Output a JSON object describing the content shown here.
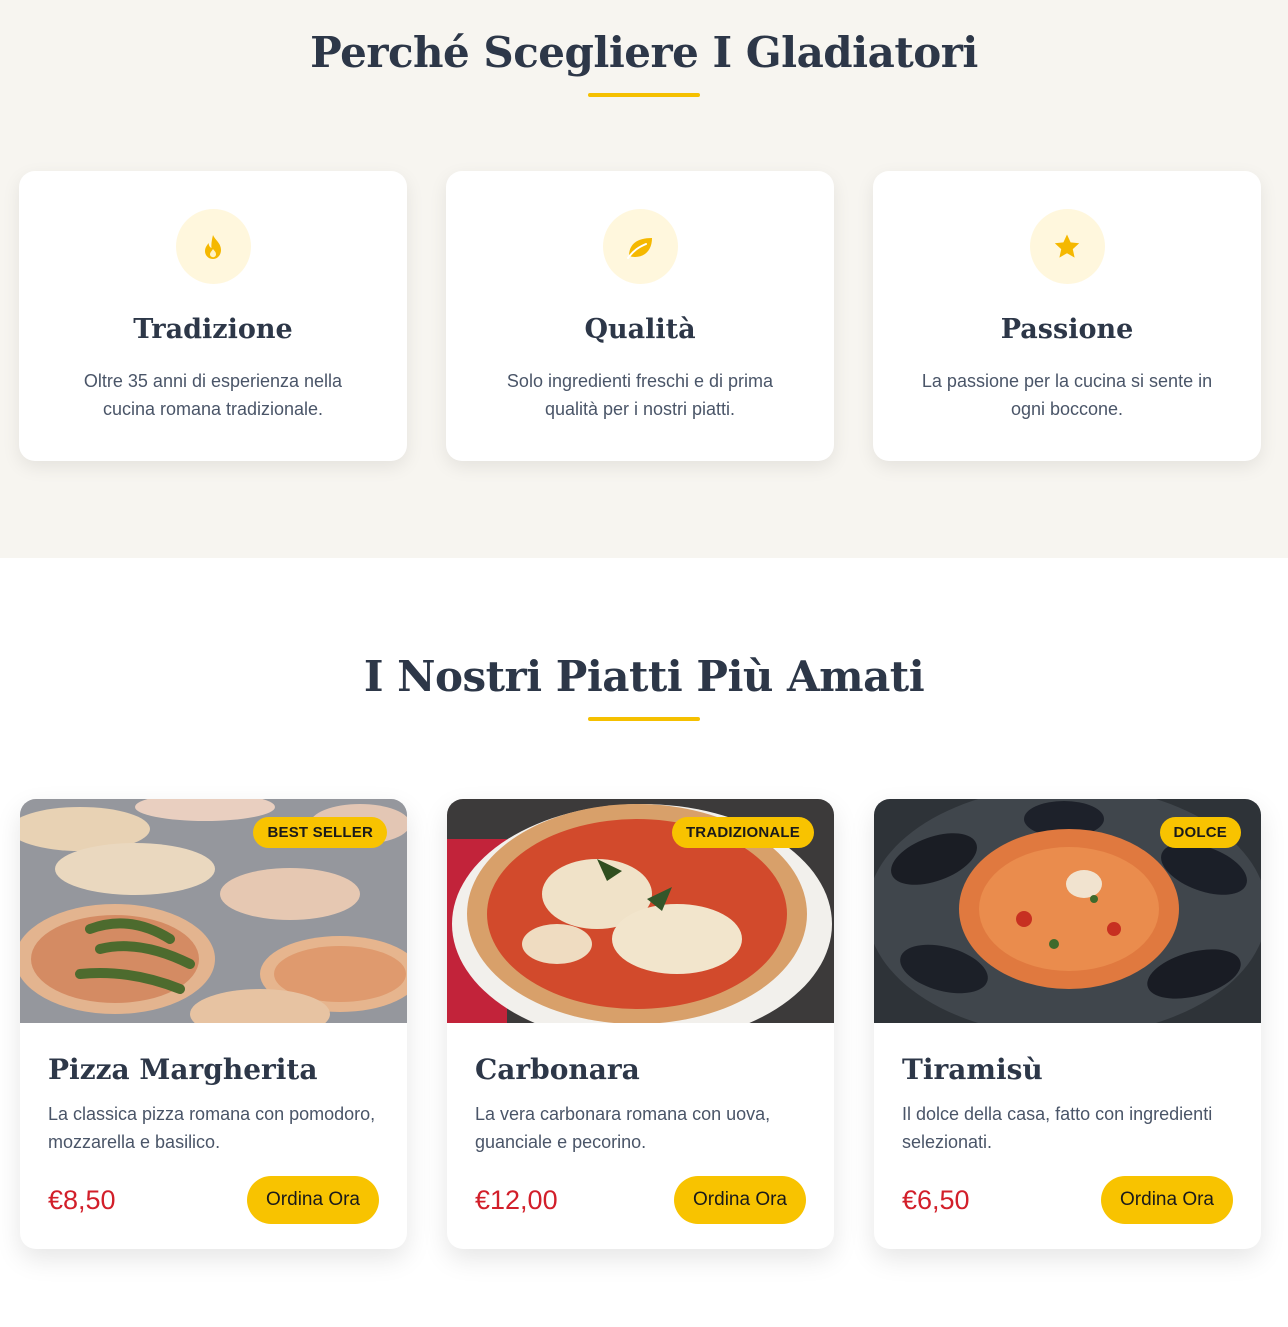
{
  "why_section": {
    "title": "Perché Scegliere I Gladiatori",
    "features": [
      {
        "icon": "fire-icon",
        "title": "Tradizione",
        "text": "Oltre 35 anni di esperienza nella cucina romana tradizionale."
      },
      {
        "icon": "leaf-icon",
        "title": "Qualità",
        "text": "Solo ingredienti freschi e di prima qualità per i nostri piatti."
      },
      {
        "icon": "star-icon",
        "title": "Passione",
        "text": "La passione per la cucina si sente in ogni boccone."
      }
    ]
  },
  "dishes_section": {
    "title": "I Nostri Piatti Più Amati",
    "dishes": [
      {
        "badge": "BEST SELLER",
        "name": "Pizza Margherita",
        "description": "La classica pizza romana con pomodoro, mozzarella e basilico.",
        "price": "€8,50",
        "button": "Ordina Ora"
      },
      {
        "badge": "TRADIZIONALE",
        "name": "Carbonara",
        "description": "La vera carbonara romana con uova, guanciale e pecorino.",
        "price": "€12,00",
        "button": "Ordina Ora"
      },
      {
        "badge": "DOLCE",
        "name": "Tiramisù",
        "description": "Il dolce della casa, fatto con ingredienti selezionati.",
        "price": "€6,50",
        "button": "Ordina Ora"
      }
    ]
  },
  "colors": {
    "accent": "#f5c000",
    "price": "#d21f2a",
    "beige_bg": "#f7f5f0",
    "heading": "#2d3748"
  }
}
